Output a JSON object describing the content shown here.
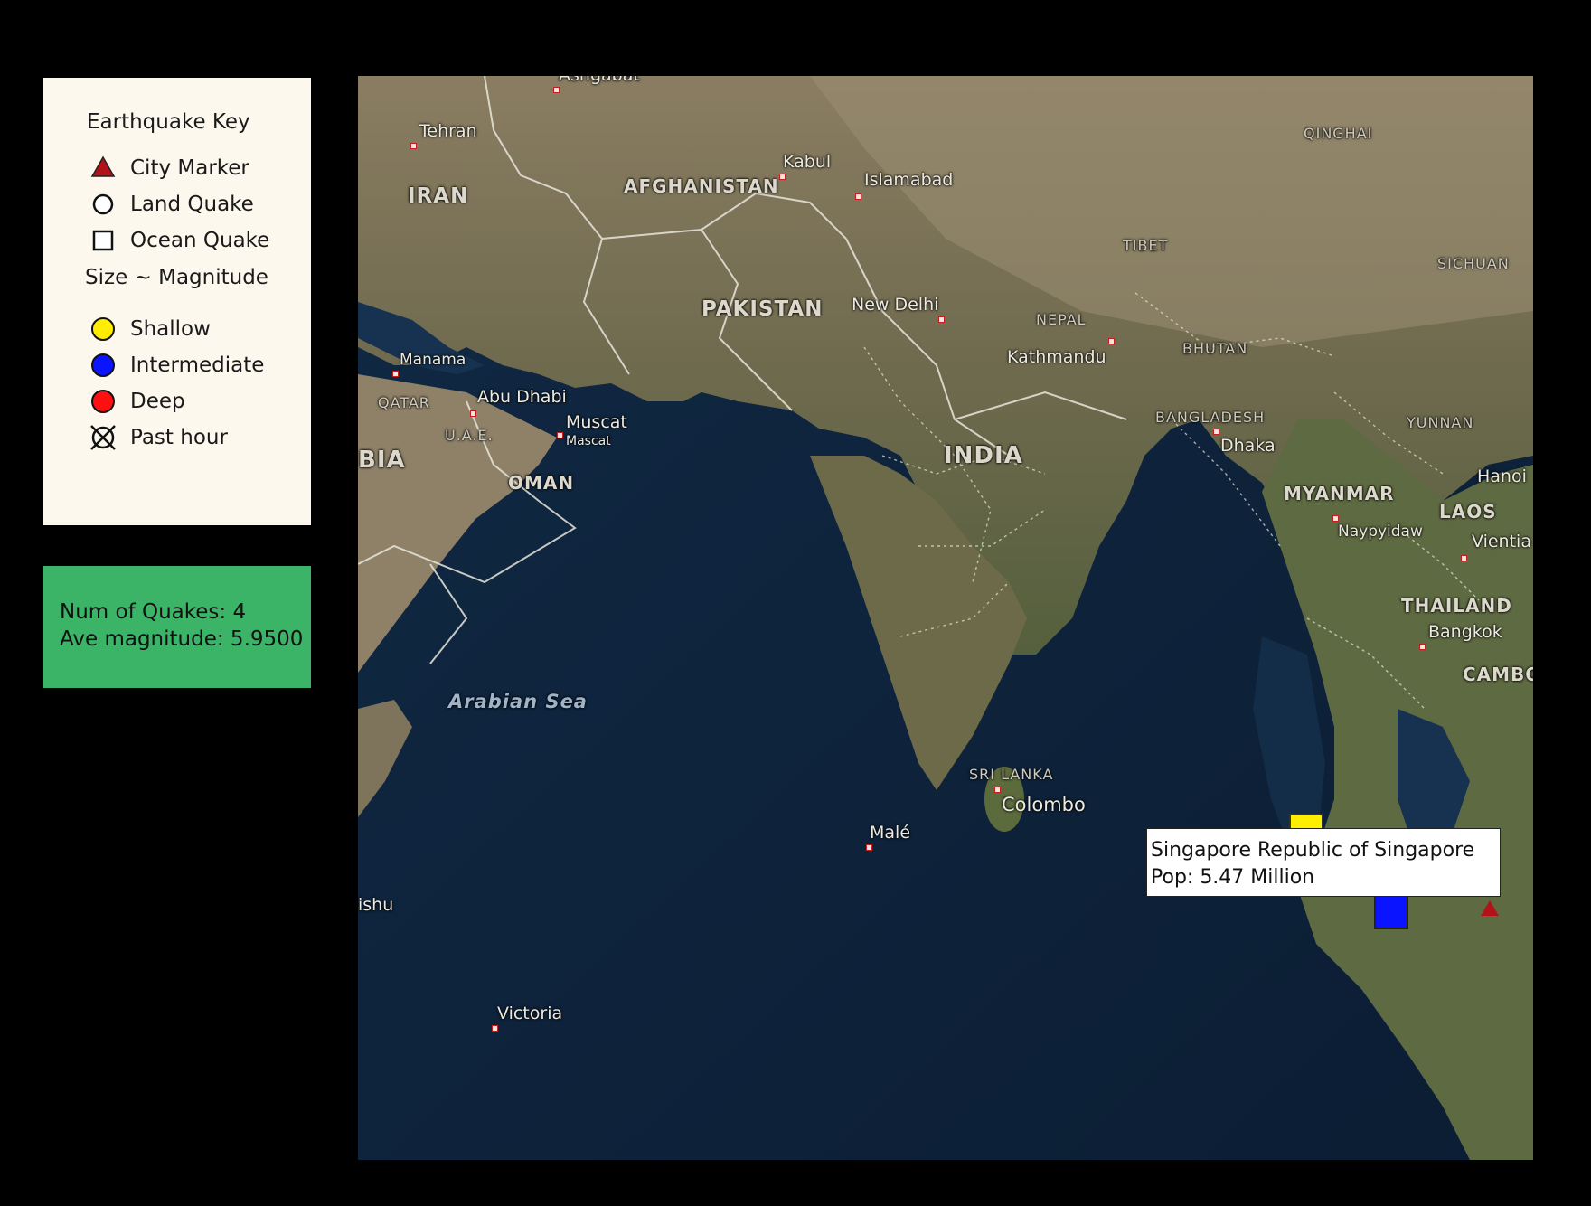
{
  "key": {
    "title": "Earthquake Key",
    "items": [
      {
        "icon": "city-marker-icon",
        "label": "City Marker"
      },
      {
        "icon": "land-quake-icon",
        "label": "Land Quake"
      },
      {
        "icon": "ocean-quake-icon",
        "label": "Ocean Quake"
      }
    ],
    "size_note": "Size ~ Magnitude",
    "depth_items": [
      {
        "icon": "shallow-icon",
        "label": "Shallow",
        "color": "#ffee00"
      },
      {
        "icon": "intermediate-icon",
        "label": "Intermediate",
        "color": "#0a14ff"
      },
      {
        "icon": "deep-icon",
        "label": "Deep",
        "color": "#ff1010"
      }
    ],
    "past_hour": {
      "icon": "past-hour-icon",
      "label": "Past hour"
    }
  },
  "stats": {
    "num_quakes": "Num of Quakes: 4",
    "ave_magnitude": "Ave magnitude: 5.9500"
  },
  "map": {
    "countries": [
      "IRAN",
      "AFGHANISTAN",
      "PAKISTAN",
      "INDIA",
      "OMAN",
      "MYANMAR",
      "THAILAND",
      "LAOS",
      "NEPAL",
      "BHUTAN",
      "BANGLADESH",
      "SRI LANKA",
      "QATAR",
      "U.A.E.",
      "CAMBO",
      "BIA"
    ],
    "regions": [
      "QINGHAI",
      "TIBET",
      "SICHUAN",
      "YUNNAN"
    ],
    "cities": [
      "Tehran",
      "Kabul",
      "Islamabad",
      "New Delhi",
      "Kathmandu",
      "Dhaka",
      "Manama",
      "Abu Dhabi",
      "Muscat",
      "Mascat",
      "Naypyidaw",
      "Bangkok",
      "Hanoi",
      "Vientia",
      "Colombo",
      "Malé",
      "Victoria",
      "ishu",
      "Ashgabat"
    ],
    "seas": [
      "Arabian Sea"
    ]
  },
  "tooltip": {
    "line1": "Singapore Republic of Singapore",
    "line2": "Pop: 5.47 Million"
  },
  "colors": {
    "key_bg": "#fdf8ee",
    "stats_bg": "#3cb468",
    "ocean": "#0f2238",
    "land": "#7a6f57"
  }
}
